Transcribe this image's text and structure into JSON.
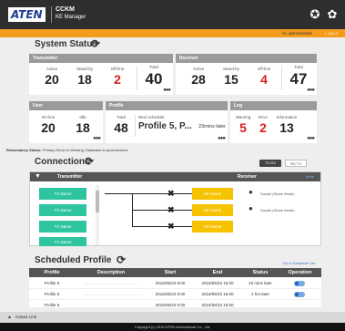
{
  "header": {
    "brand": "ATEN",
    "app_title": "CCKM",
    "app_subtitle": "KE Manager",
    "user_label": "Hi, administrator",
    "logout_label": "Logout"
  },
  "system_status": {
    "title": "System Status",
    "transmitter": {
      "title": "Transmitter",
      "stats": [
        {
          "label": "Active",
          "value": "20"
        },
        {
          "label": "Stand-by",
          "value": "18"
        },
        {
          "label": "Off-line",
          "value": "2"
        },
        {
          "label": "Total",
          "value": "40"
        }
      ]
    },
    "receiver": {
      "title": "Receiver",
      "stats": [
        {
          "label": "Active",
          "value": "28"
        },
        {
          "label": "Stand-by",
          "value": "15"
        },
        {
          "label": "Off-line",
          "value": "4"
        },
        {
          "label": "Total",
          "value": "47"
        }
      ]
    },
    "user": {
      "title": "User",
      "stats": [
        {
          "label": "On-line",
          "value": "20"
        },
        {
          "label": "Idle",
          "value": "18"
        }
      ]
    },
    "profile": {
      "title": "Profile",
      "total_label": "Total",
      "total_value": "48",
      "next_label": "Next schedule",
      "next_value": "Profile 5, P...",
      "next_time": "23mins later"
    },
    "log": {
      "title": "Log",
      "stats": [
        {
          "label": "Warning",
          "value": "5"
        },
        {
          "label": "Error",
          "value": "2"
        },
        {
          "label": "Information",
          "value": "13"
        }
      ]
    },
    "more": "●●●",
    "redundancy_label": "Redundancy Status:",
    "redundancy_text": "Primary Sever is Working. Database is synchronized."
  },
  "connections": {
    "title": "Connections",
    "toggle_tx": "TX-RX",
    "toggle_rx": "RX-TX",
    "col_transmitter": "Transmitter",
    "col_receiver": "Receiver",
    "more_link": "More",
    "tx_items": [
      "TX Name",
      "TX Name",
      "TX Name",
      "TX Name"
    ],
    "rx_items": [
      "KE Name",
      "KE Name",
      "KE Name"
    ],
    "users": [
      "Suzuki (Share Mode)",
      "Suzuki (Share Mode)"
    ]
  },
  "scheduled_profile": {
    "title": "Scheduled Profile",
    "link": "Go to Schedule List",
    "columns": [
      "Profile",
      "Description",
      "Start",
      "End",
      "Status",
      "Operation"
    ],
    "rows": [
      {
        "profile": "Profile 5",
        "description": "................................................",
        "start": "2016/05/23 9:00",
        "end": "2016/05/23 16:00",
        "status": "23 mins later"
      },
      {
        "profile": "Profile 6",
        "description": "................................................",
        "start": "2016/05/23 9:00",
        "end": "2016/05/23 16:00",
        "status": "2 hrs later"
      },
      {
        "profile": "Profile 5",
        "description": "",
        "start": "2016/05/23 9:00",
        "end": "2016/05/23 16:00",
        "status": ""
      }
    ]
  },
  "bottom": {
    "instant_link": "Instant Link"
  },
  "footer": {
    "copyright": "Copyright (c) 2016 ATEN International Co., Ltd."
  },
  "colors": {
    "accent": "#f29b1d",
    "tx": "#2ec4a0",
    "rx": "#f6c300",
    "alert": "#d7201f"
  }
}
